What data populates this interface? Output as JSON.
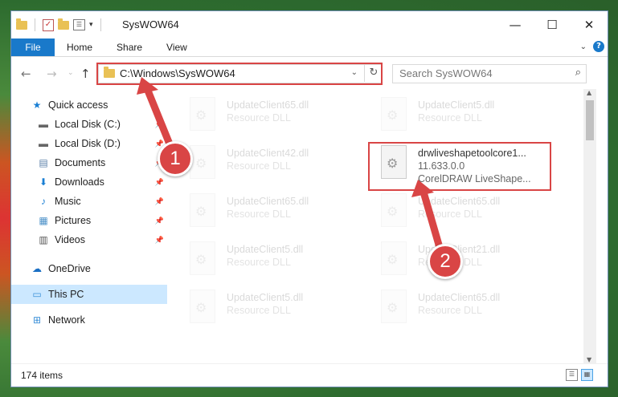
{
  "window": {
    "title": "SysWOW64",
    "controls": {
      "minimize": "—",
      "maximize": "☐",
      "close": "✕"
    }
  },
  "ribbon": {
    "tabs": [
      {
        "label": "File",
        "active": true
      },
      {
        "label": "Home"
      },
      {
        "label": "Share"
      },
      {
        "label": "View"
      }
    ],
    "help": "?"
  },
  "address": {
    "path": "C:\\Windows\\SysWOW64",
    "refresh": "↻",
    "dropdown": "⌄"
  },
  "search": {
    "placeholder": "Search SysWOW64",
    "icon": "⌕"
  },
  "nav": {
    "back": "←",
    "forward": "→",
    "up": "↑",
    "items": [
      {
        "label": "Quick access",
        "icon": "star-icon",
        "glyph": "★",
        "color": "#1a7fd4"
      },
      {
        "label": "Local Disk (C:)",
        "icon": "drive-icon",
        "glyph": "▬",
        "color": "#666",
        "pinned": true
      },
      {
        "label": "Local Disk (D:)",
        "icon": "drive-icon",
        "glyph": "▬",
        "color": "#666",
        "pinned": true
      },
      {
        "label": "Documents",
        "icon": "documents-icon",
        "glyph": "▤",
        "color": "#5a7fa8",
        "pinned": true
      },
      {
        "label": "Downloads",
        "icon": "downloads-icon",
        "glyph": "⬇",
        "color": "#1a7fd4",
        "pinned": true
      },
      {
        "label": "Music",
        "icon": "music-icon",
        "glyph": "♪",
        "color": "#1a7fd4",
        "pinned": true
      },
      {
        "label": "Pictures",
        "icon": "pictures-icon",
        "glyph": "▦",
        "color": "#4a90c8",
        "pinned": true
      },
      {
        "label": "Videos",
        "icon": "videos-icon",
        "glyph": "▥",
        "color": "#555",
        "pinned": true
      },
      {
        "label": "OneDrive",
        "icon": "onedrive-icon",
        "glyph": "☁",
        "color": "#1a6fc4"
      },
      {
        "label": "This PC",
        "icon": "computer-icon",
        "glyph": "▭",
        "color": "#3a8fd8",
        "selected": true
      },
      {
        "label": "Network",
        "icon": "network-icon",
        "glyph": "⊞",
        "color": "#3a8fd8"
      }
    ]
  },
  "files": [
    {
      "name": "UpdateClient65.dll",
      "type": "Resource DLL",
      "col": 0,
      "row": 0
    },
    {
      "name": "UpdateClient5.dll",
      "type": "Resource DLL",
      "col": 1,
      "row": 0
    },
    {
      "name": "UpdateClient42.dll",
      "type": "Resource DLL",
      "col": 0,
      "row": 1
    },
    {
      "name": "drwliveshapetoolcore1...",
      "version": "11.633.0.0",
      "type": "CorelDRAW LiveShape...",
      "col": 1,
      "row": 1,
      "highlighted": true
    },
    {
      "name": "UpdateClient65.dll",
      "type": "Resource DLL",
      "col": 0,
      "row": 2
    },
    {
      "name": "UpdateClient65.dll",
      "type": "Resource DLL",
      "col": 1,
      "row": 2
    },
    {
      "name": "UpdateClient5.dll",
      "type": "Resource DLL",
      "col": 0,
      "row": 3
    },
    {
      "name": "UpdateClient21.dll",
      "type": "Resource DLL",
      "col": 1,
      "row": 3
    },
    {
      "name": "UpdateClient5.dll",
      "type": "Resource DLL",
      "col": 0,
      "row": 4
    },
    {
      "name": "UpdateClient65.dll",
      "type": "Resource DLL",
      "col": 1,
      "row": 4
    }
  ],
  "status": {
    "item_count": "174 items"
  },
  "callouts": [
    {
      "label": "1"
    },
    {
      "label": "2"
    }
  ],
  "colors": {
    "accent": "#1979ca",
    "highlight": "#d94545",
    "selection": "#cce8ff"
  }
}
